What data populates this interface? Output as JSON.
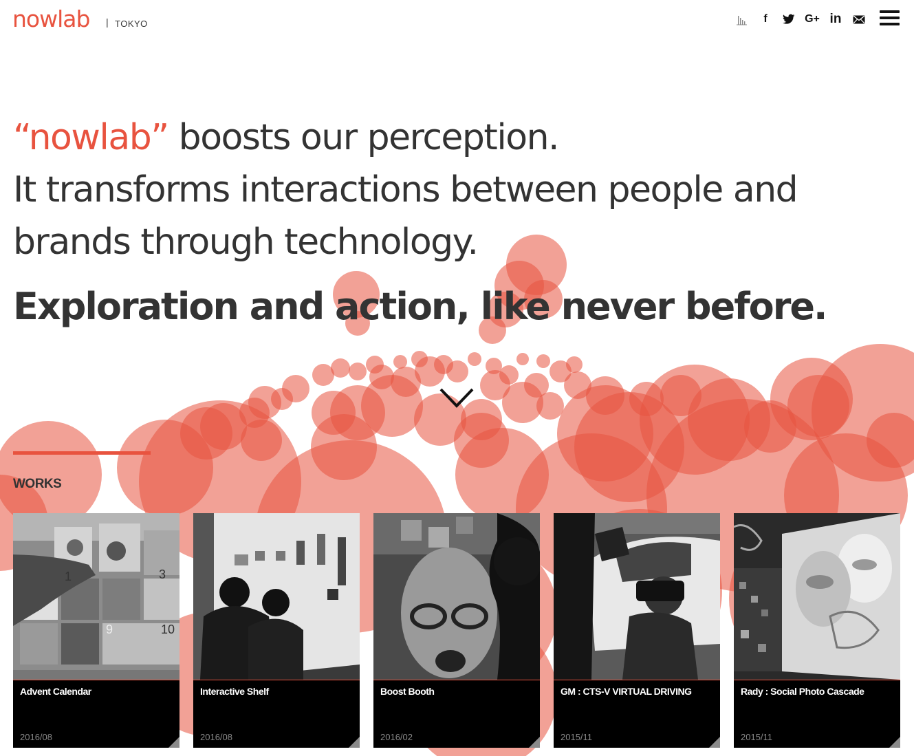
{
  "header": {
    "logo": "nowlab",
    "separator": "|",
    "city": "TOKYO",
    "social_icons": [
      "bars-chart-icon",
      "facebook-icon",
      "twitter-icon",
      "google-plus-icon",
      "linkedin-icon",
      "mail-icon"
    ],
    "social_text": {
      "facebook": "f",
      "google_plus": "G+",
      "linkedin": "in"
    },
    "menu_icon": "hamburger-menu-icon"
  },
  "hero": {
    "accent": "“nowlab”",
    "line1_rest": " boosts our perception.",
    "line2": "It transforms interactions between people and",
    "line3": "brands through technology.",
    "tagline": "Exploration and action, like never before."
  },
  "works": {
    "title": "WORKS",
    "items": [
      {
        "title": "Advent Calendar",
        "date": "2016/08"
      },
      {
        "title": "Interactive Shelf",
        "date": "2016/08"
      },
      {
        "title": "Boost Booth",
        "date": "2016/02"
      },
      {
        "title": "GM : CTS-V VIRTUAL DRIVING",
        "date": "2015/11"
      },
      {
        "title": "Rady : Social Photo Cascade",
        "date": "2015/11"
      }
    ]
  },
  "colors": {
    "accent": "#e8533f",
    "text": "#333333",
    "card_bg": "#000000"
  }
}
